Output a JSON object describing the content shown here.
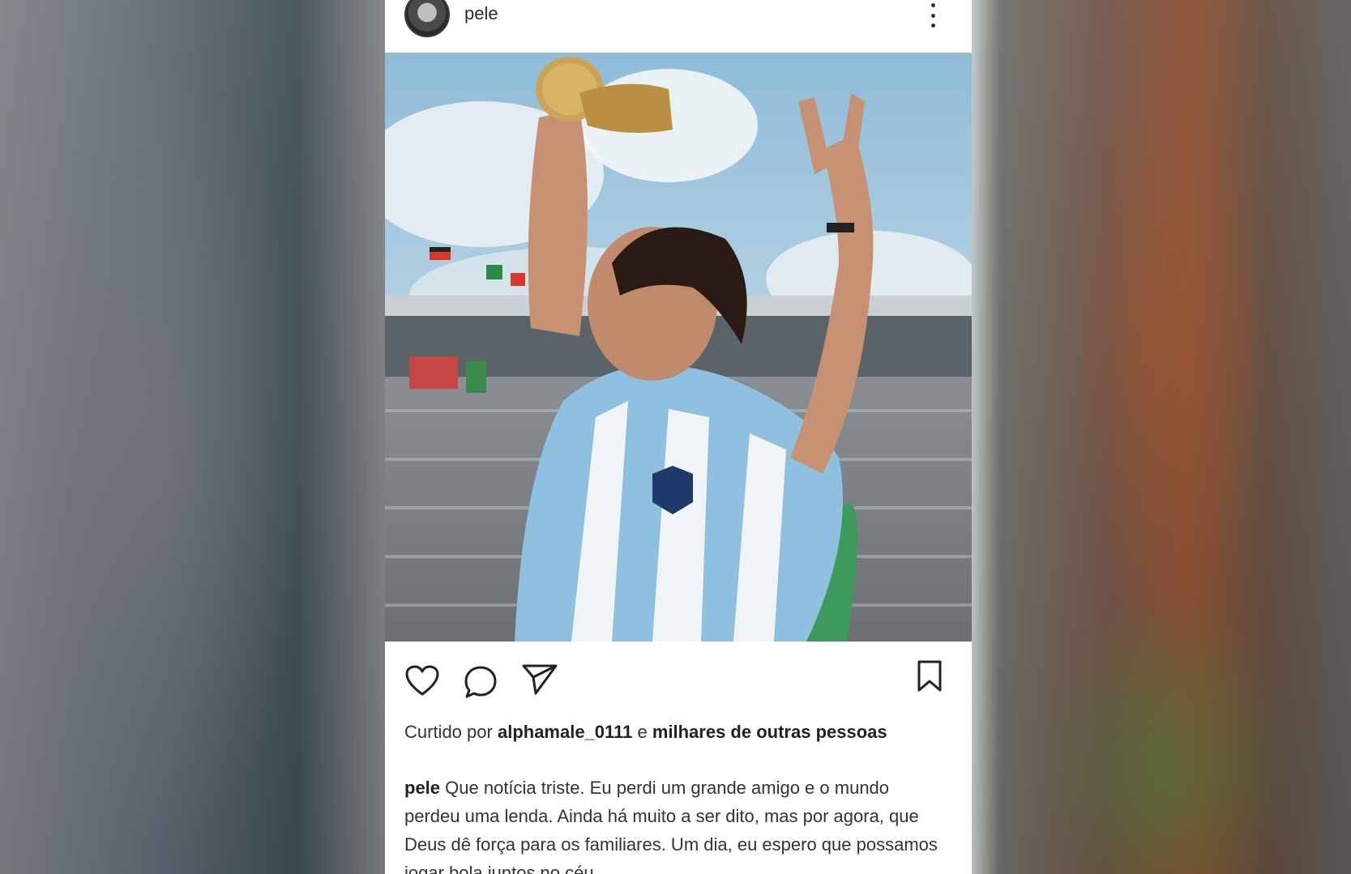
{
  "post": {
    "username": "pele",
    "photo_alt": "",
    "liked_prefix": "Curtido por",
    "liked_user": "alphamale_0111",
    "liked_conj": "e",
    "liked_suffix": "milhares de outras pessoas",
    "caption_user": "pele",
    "caption_text": "Que notícia triste. Eu perdi um grande amigo e o mundo perdeu uma lenda. Ainda há muito a ser dito, mas por agora, que Deus dê força para os familiares. Um dia, eu espero que possamos jogar bola juntos no céu."
  },
  "icons": {
    "more": "more-vertical-icon",
    "like": "heart-icon",
    "comment": "comment-icon",
    "share": "send-icon",
    "save": "bookmark-icon"
  },
  "colors": {
    "sky": "#9ec6de",
    "jersey_blue": "#8fbfe0",
    "background_brown": "#8a4b2e"
  }
}
